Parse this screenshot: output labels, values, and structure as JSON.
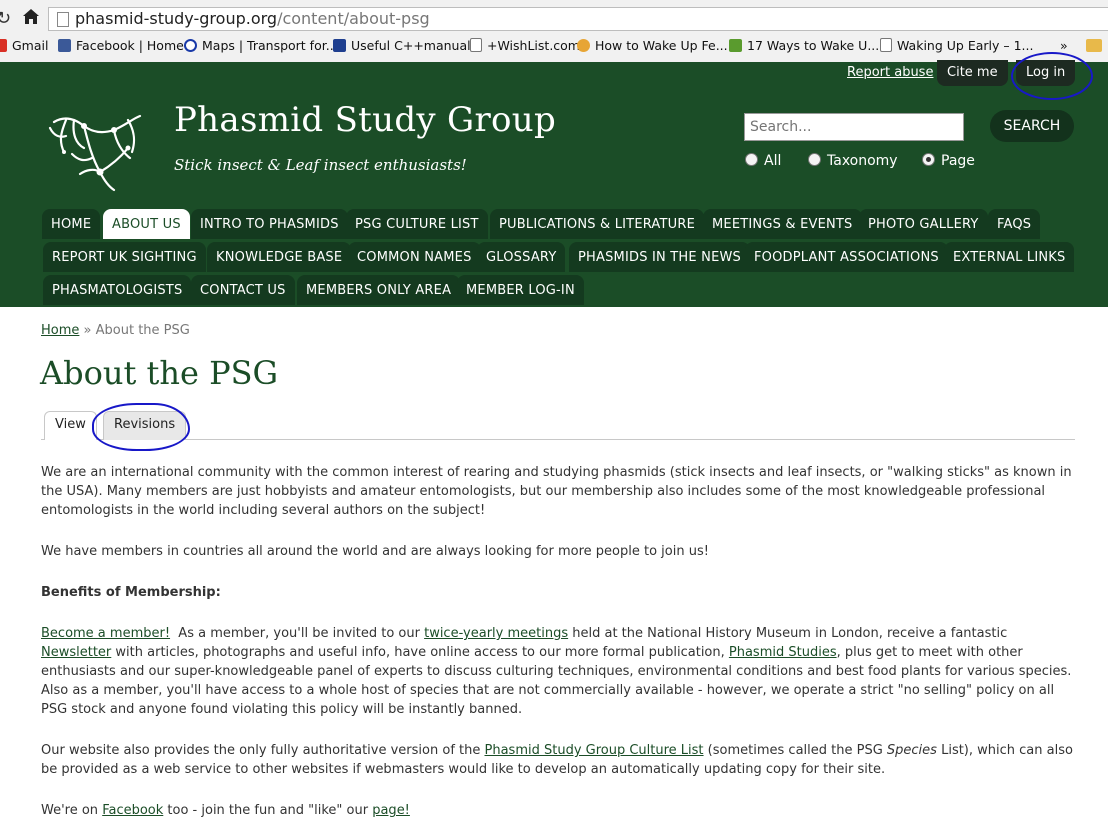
{
  "browser": {
    "url_domain": "phasmid-study-group.org",
    "url_path": "/content/about-psg",
    "bookmarks": [
      "Gmail",
      "Facebook | Home",
      "Maps | Transport for...",
      "Useful C++manual",
      "+WishList.com",
      "How to Wake Up Fe...",
      "17 Ways to Wake U...",
      "Waking Up Early – 1..."
    ],
    "more": "»"
  },
  "header": {
    "report_abuse": "Report abuse",
    "cite_me": "Cite me",
    "login": "Log in",
    "site_name": "Phasmid Study Group",
    "slogan": "Stick insect & Leaf insect enthusiasts!",
    "search_placeholder": "Search...",
    "search_button": "SEARCH",
    "radios": [
      {
        "label": "All",
        "selected": false
      },
      {
        "label": "Taxonomy",
        "selected": false
      },
      {
        "label": "Page",
        "selected": true
      }
    ]
  },
  "nav": {
    "row1": [
      "HOME",
      "ABOUT US",
      "INTRO TO PHASMIDS",
      "PSG CULTURE LIST",
      "PUBLICATIONS & LITERATURE",
      "MEETINGS & EVENTS",
      "PHOTO GALLERY",
      "FAQS"
    ],
    "row2": [
      "REPORT UK SIGHTING",
      "KNOWLEDGE BASE",
      "COMMON NAMES",
      "GLOSSARY",
      "PHASMIDS IN THE NEWS",
      "FOODPLANT ASSOCIATIONS",
      "EXTERNAL LINKS"
    ],
    "row3": [
      "PHASMATOLOGISTS",
      "CONTACT US",
      "MEMBERS ONLY AREA",
      "MEMBER LOG-IN"
    ],
    "active": "ABOUT US"
  },
  "breadcrumb": {
    "home": "Home",
    "sep": "»",
    "current": "About the PSG"
  },
  "page": {
    "title": "About the PSG",
    "tabs": [
      "View",
      "Revisions"
    ],
    "p1": "We are an international community with the common interest of rearing and studying phasmids (stick insects and leaf insects, or \"walking sticks\" as known in the USA).  Many members are just hobbyists and amateur entomologists, but our membership also includes some of the most knowledgeable professional entomologists in the world including several authors on the subject!",
    "p2": "We have members in countries all around the world and are always looking for more people to join us!",
    "p3": "Benefits of Membership:",
    "p4": {
      "link1": "Become a member!",
      "t1": "  As a member, you'll be invited to our ",
      "link2": "twice-yearly meetings",
      "t2": " held at the National History Museum in London, receive a fantastic ",
      "link3": "Newsletter",
      "t3": " with articles, photographs and useful info, have online access to our more formal publication, ",
      "link4": "Phasmid Studies",
      "t4": ", plus get to meet with other enthusiasts and our super-knowledgeable panel of experts to discuss culturing techniques, environmental conditions and best food plants for various species.  Also as a member, you'll have access to a whole host of species that are not commercially available - however, we operate a strict \"no selling\" policy on all PSG stock and anyone found violating this policy will be instantly banned."
    },
    "p5": {
      "t1": "Our website also provides the only fully authoritative version of the ",
      "link1": "Phasmid Study Group Culture List",
      "t2": " (sometimes called the PSG ",
      "em": "Species",
      "t3": " List), which can also be provided as a web service to other websites if webmasters would like to develop an automatically updating copy for their site."
    },
    "p6": {
      "t1": "We're on ",
      "link1": "Facebook",
      "t2": " too - join the fun and \"like\" our ",
      "link2": "page!"
    }
  },
  "colors": {
    "header_bg": "#1b4d27",
    "tab_bg": "#143a1f",
    "annotation": "#1818c8"
  }
}
